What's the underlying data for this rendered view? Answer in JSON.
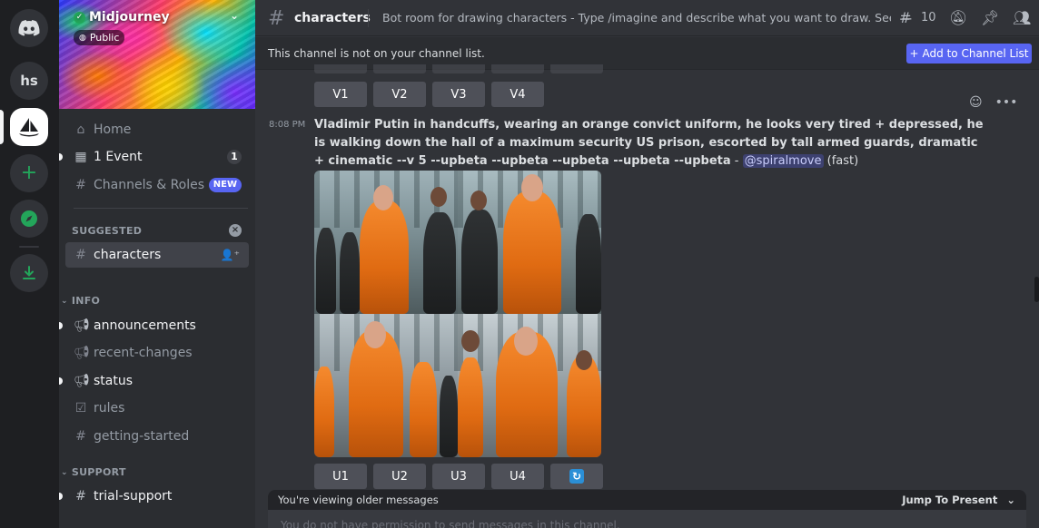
{
  "rail": {
    "user_initials": "hs"
  },
  "server": {
    "name": "Midjourney",
    "visibility": "Public"
  },
  "sidebar": {
    "home": "Home",
    "events": "1 Event",
    "events_count": "1",
    "channels_roles": "Channels & Roles",
    "new_badge": "NEW",
    "suggested_label": "SUGGESTED",
    "suggested_channel": "characters",
    "info_category": "INFO",
    "info_channels": [
      "announcements",
      "recent-changes",
      "status",
      "rules",
      "getting-started"
    ],
    "support_category": "SUPPORT",
    "support_channels": [
      "trial-support"
    ]
  },
  "header": {
    "channel": "characters",
    "topic": "Bot room for drawing characters - Type /imagine and describe what you want to draw. See the #docs ...",
    "thread_count": "10"
  },
  "notice": {
    "text": "This channel is not on your channel list.",
    "button": "Add to Channel List"
  },
  "variation_buttons": [
    "V1",
    "V2",
    "V3",
    "V4"
  ],
  "message": {
    "time": "8:08 PM",
    "prompt": "Vladimir Putin in handcuffs, wearing an orange convict uniform, he looks very tired + depressed, he is walking down the hall of a maximum security US prison, escorted by tall armed guards, dramatic + cinematic --v 5 --upbeta --upbeta --upbeta --upbeta --upbeta",
    "separator": " - ",
    "mention": "@spiralmove",
    "mode": "(fast)"
  },
  "upscale_buttons": [
    "U1",
    "U2",
    "U3",
    "U4"
  ],
  "footer": {
    "older_messages": "You're viewing older messages",
    "jump": "Jump To Present",
    "composer_placeholder": "You do not have permission to send messages in this channel."
  },
  "colors": {
    "accent": "#5865f2",
    "online": "#23a55a",
    "background": "#313338",
    "sidebar": "#2b2d31",
    "rail": "#1e1f22"
  }
}
